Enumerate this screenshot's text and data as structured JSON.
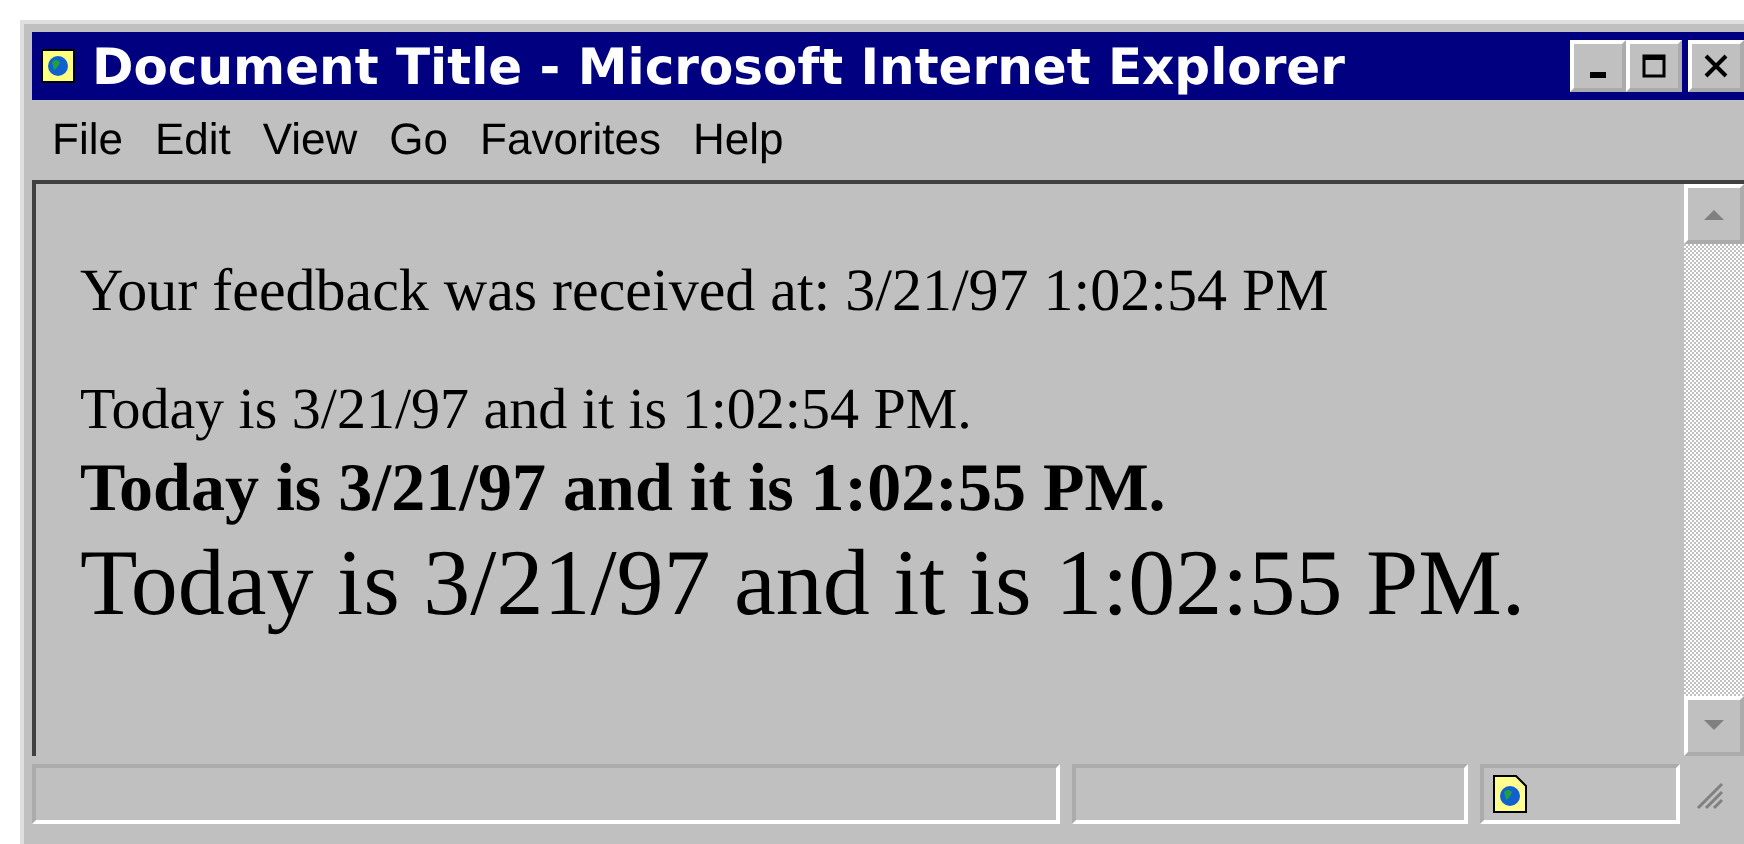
{
  "window": {
    "title": "Document Title - Microsoft Internet Explorer"
  },
  "menu": [
    "File",
    "Edit",
    "View",
    "Go",
    "Favorites",
    "Help"
  ],
  "content": {
    "lines": [
      {
        "kind": "normal",
        "text": "Your feedback was received at: 3/21/97 1:02:54 PM"
      },
      {
        "kind": "small",
        "text": "Today is 3/21/97 and it is 1:02:54 PM."
      },
      {
        "kind": "bold",
        "text": "Today is 3/21/97 and it is 1:02:55 PM."
      },
      {
        "kind": "large",
        "text": "Today is 3/21/97 and it is 1:02:55 PM."
      }
    ]
  }
}
